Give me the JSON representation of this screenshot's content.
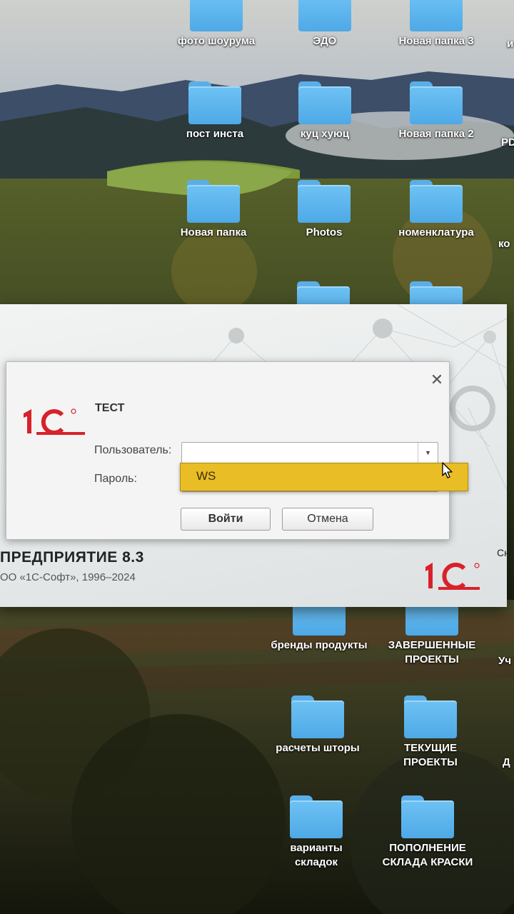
{
  "desktop": {
    "icons": [
      {
        "label": "фото шоурума"
      },
      {
        "label": "ЭДО"
      },
      {
        "label": "Новая папка 3"
      },
      {
        "label": "пост инста"
      },
      {
        "label": "куц хуюц"
      },
      {
        "label": "Новая папка 2"
      },
      {
        "label": "Новая папка"
      },
      {
        "label": "Photos"
      },
      {
        "label": "номенклатура"
      },
      {
        "label": "бренды продукты"
      },
      {
        "label": "ЗАВЕРШЕННЫЕ\nПРОЕКТЫ"
      },
      {
        "label": "расчеты шторы"
      },
      {
        "label": "ТЕКУЩИЕ\nПРОЕКТЫ"
      },
      {
        "label": "варианты\nскладок"
      },
      {
        "label": "ПОПОЛНЕНИЕ\nСКЛАДА КРАСКИ"
      }
    ],
    "partial_labels": [
      "и",
      "PD",
      "ко",
      "Уч",
      "Д"
    ]
  },
  "launcher": {
    "title": "ПРЕДПРИЯТИЕ 8.3",
    "copyright": "ОО «1С-Софт», 1996–2024",
    "edge_text": "Сн"
  },
  "login_dialog": {
    "database_name": "ТЕСТ",
    "user_label": "Пользователь:",
    "user_value": "",
    "password_label": "Пароль:",
    "ok_button": "Войти",
    "cancel_button": "Отмена",
    "close_glyph": "✕",
    "dropdown_glyph": "▼",
    "dropdown_options": [
      "WS"
    ],
    "highlight_color": "#e9bd25"
  },
  "logo": {
    "text": "1С",
    "color": "#d8212a"
  }
}
